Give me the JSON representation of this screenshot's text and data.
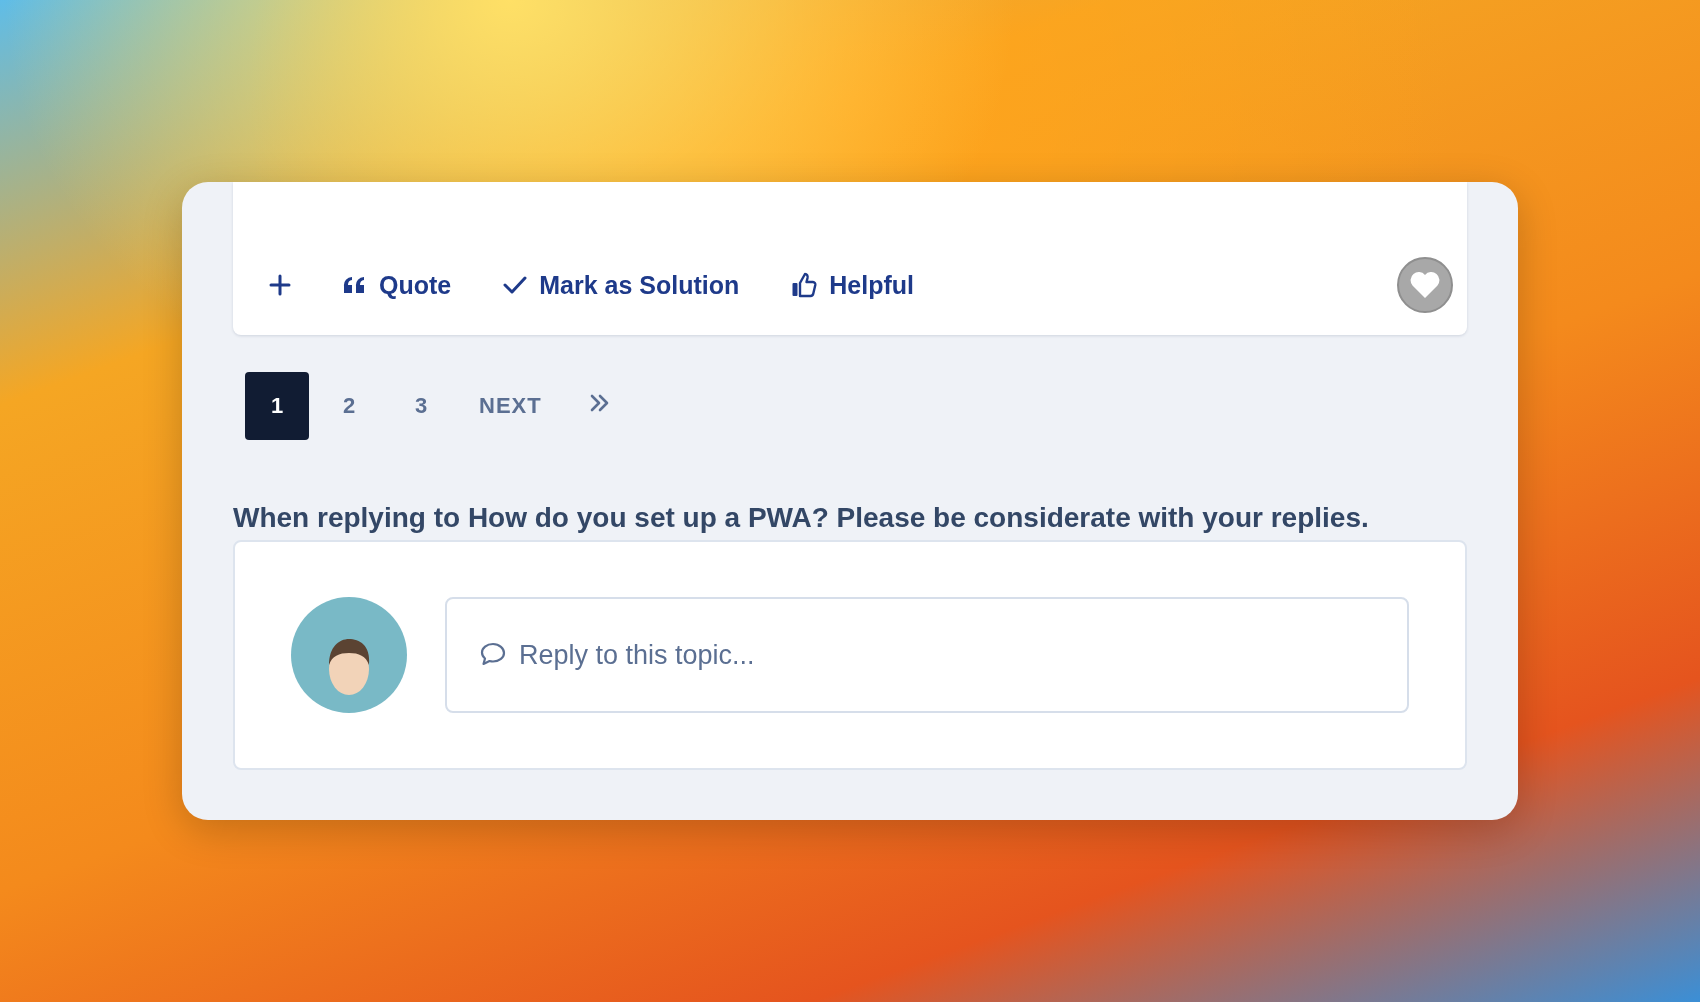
{
  "post": {
    "actions": [
      {
        "kind": "add"
      },
      {
        "kind": "quote",
        "label": "Quote"
      },
      {
        "kind": "solution",
        "label": "Mark as Solution"
      },
      {
        "kind": "helpful",
        "label": "Helpful"
      }
    ],
    "liked": false
  },
  "pagination": {
    "pages": [
      {
        "label": "1",
        "selected": true
      },
      {
        "label": "2",
        "selected": false
      },
      {
        "label": "3",
        "selected": false
      }
    ],
    "next": "NEXT"
  },
  "reply": {
    "heading": "When replying to How do you set up a PWA? Please be considerate with your replies.",
    "placeholder": "Reply to this topic..."
  }
}
